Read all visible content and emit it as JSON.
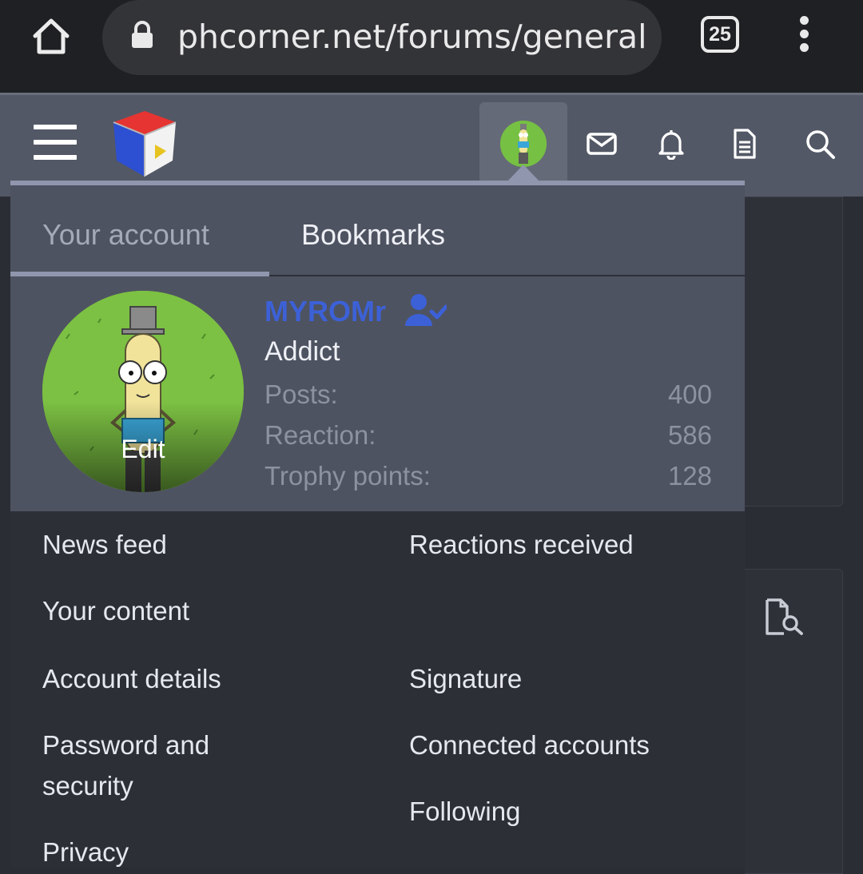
{
  "browser": {
    "url": "phcorner.net/forums/general",
    "tab_count": "25"
  },
  "colors": {
    "accent": "#8f96ad",
    "username": "#3c61d7",
    "header": "#535866",
    "menu_bg": "#2d2f37"
  },
  "menu": {
    "tabs": [
      {
        "label": "Your account"
      },
      {
        "label": "Bookmarks"
      }
    ],
    "profile": {
      "username": "MYROMr",
      "title": "Addict",
      "edit_label": "Edit",
      "stats": [
        {
          "label": "Posts:",
          "value": "400"
        },
        {
          "label": "Reaction:",
          "value": "586"
        },
        {
          "label": "Trophy points:",
          "value": "128"
        }
      ]
    },
    "links_left": [
      "News feed",
      "Your content",
      "Account details",
      "Password and security",
      "Privacy"
    ],
    "links_right": [
      "Reactions received",
      "Signature",
      "Connected accounts",
      "Following"
    ]
  }
}
